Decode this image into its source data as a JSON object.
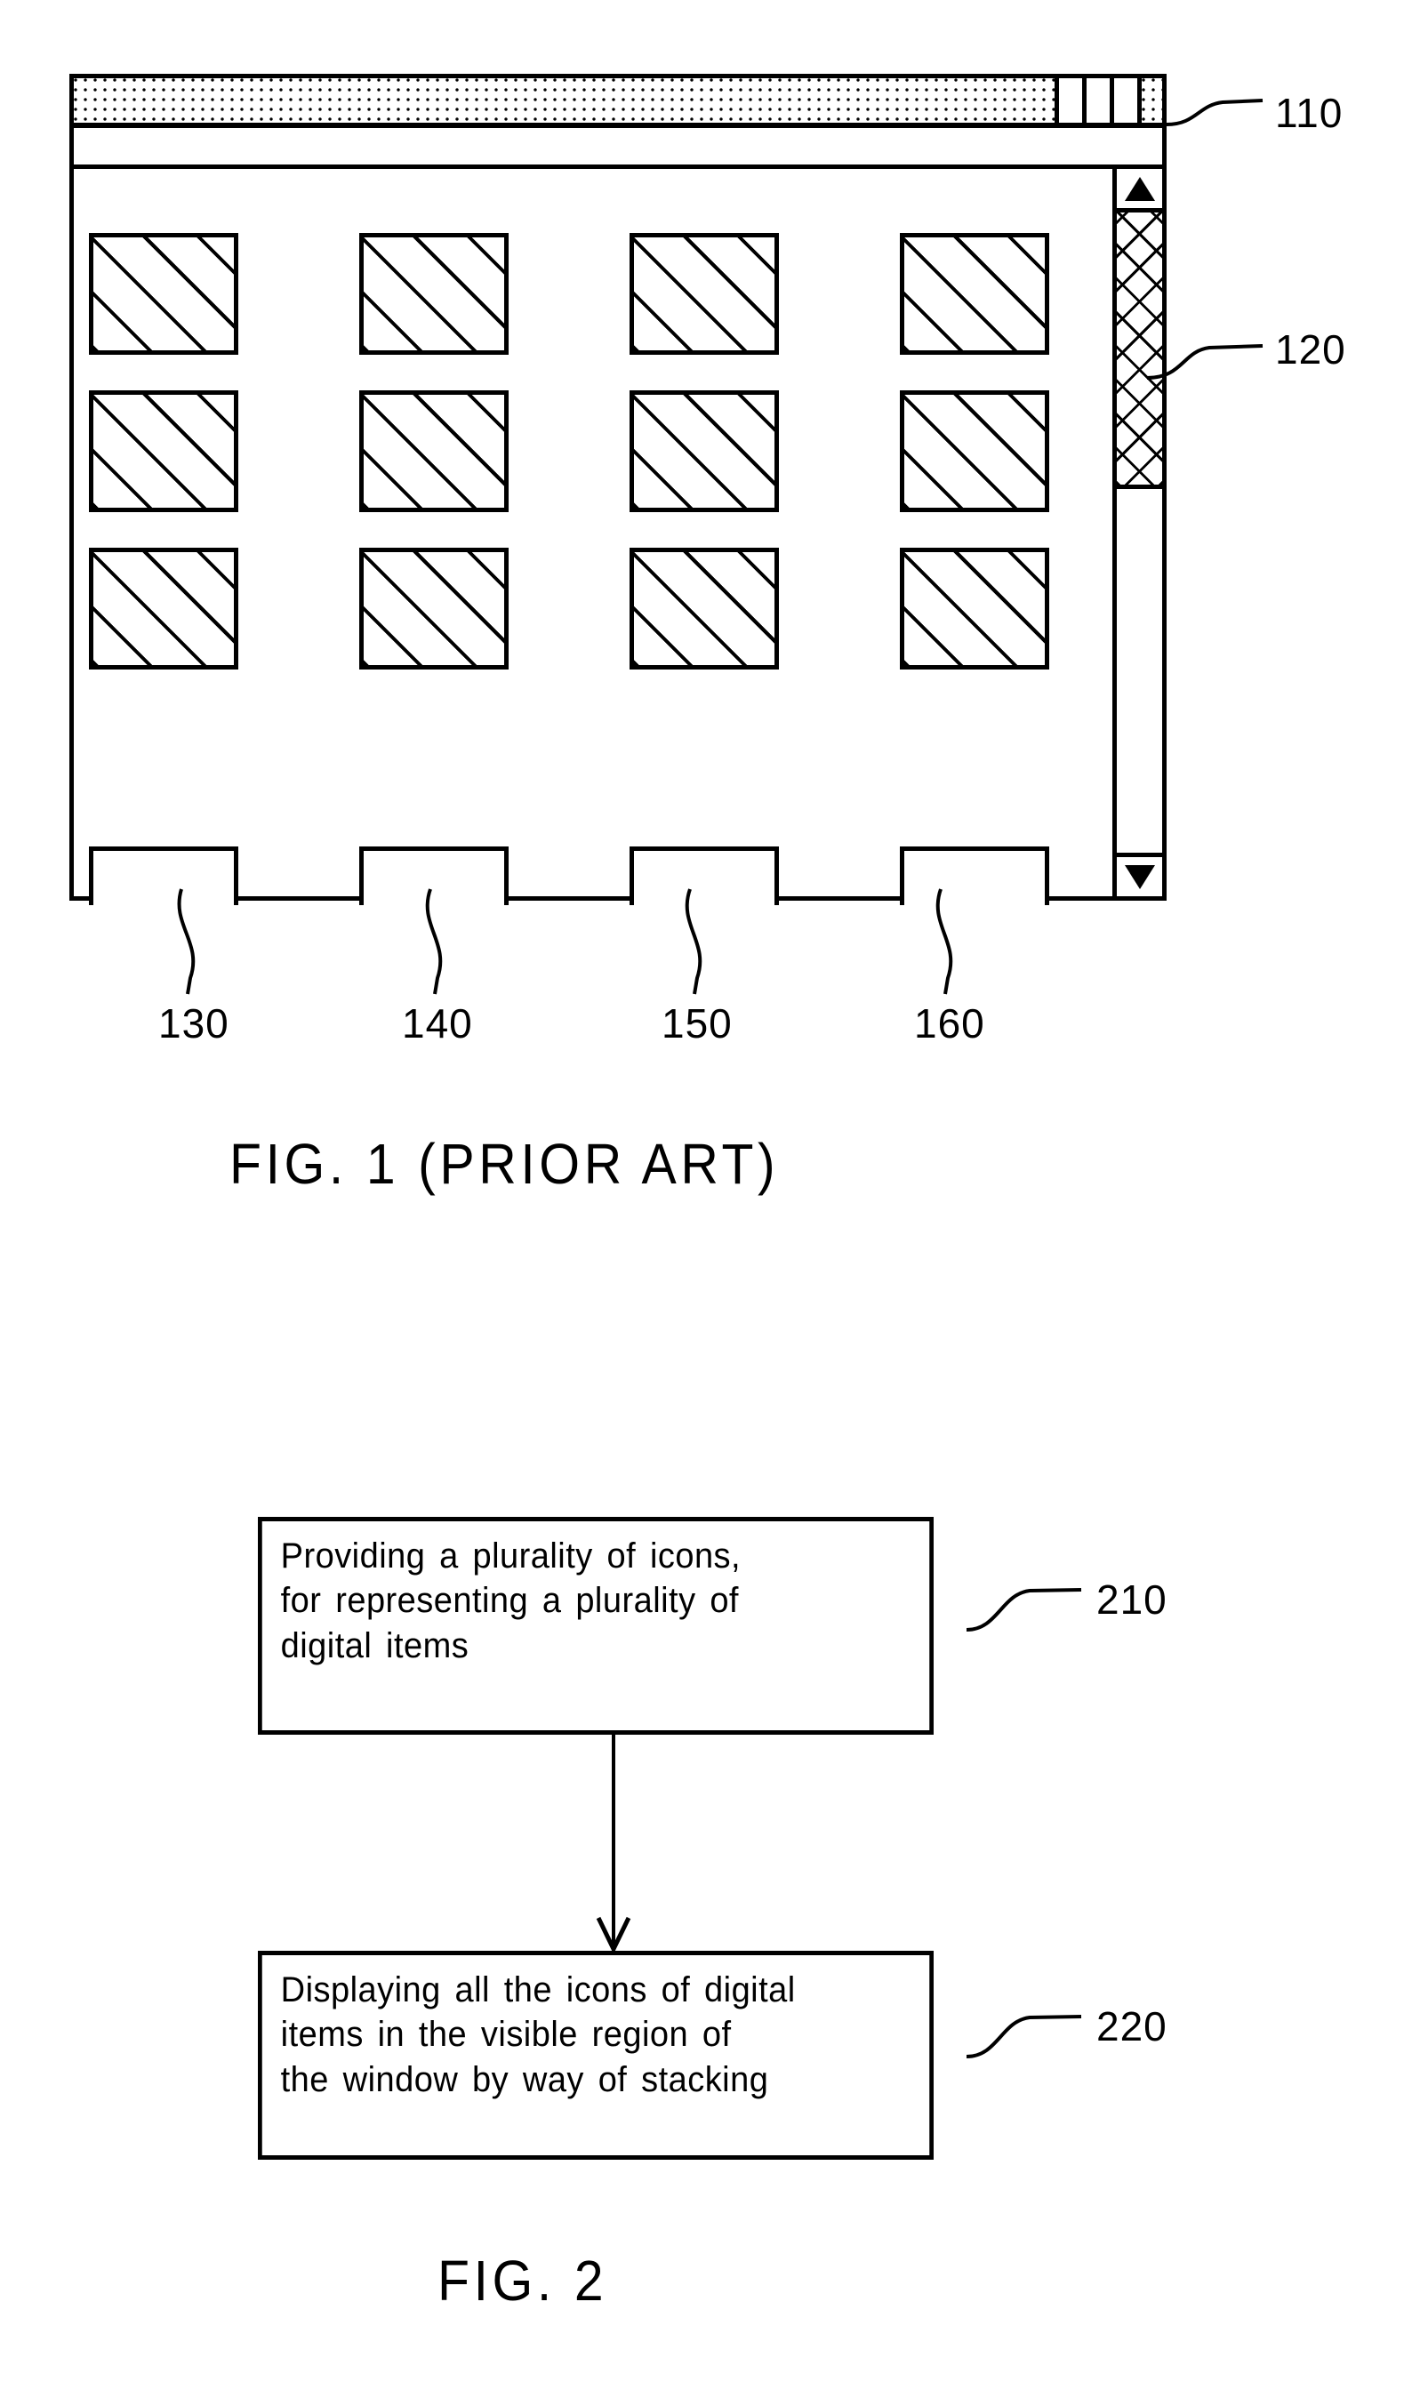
{
  "figure1": {
    "caption": "FIG. 1 (PRIOR ART)",
    "window": {
      "title_bar": {
        "name": "title-bar",
        "controls": [
          "minimize-button",
          "maximize-button",
          "close-button"
        ]
      },
      "toolbar": {
        "name": "menu-toolbar"
      },
      "scrollbar": {
        "up_arrow": "▲",
        "down_arrow": "▼",
        "thumb": "scroll-thumb"
      },
      "icon_grid": {
        "rows": 3,
        "columns": 4,
        "visible_icons": 12,
        "clipped_row_icons": 4
      }
    },
    "reference_numbers": [
      {
        "id": "110",
        "label": "110",
        "target": "window-frame"
      },
      {
        "id": "120",
        "label": "120",
        "target": "scrollbar-thumb"
      },
      {
        "id": "130",
        "label": "130",
        "target": "clipped-icon-1"
      },
      {
        "id": "140",
        "label": "140",
        "target": "clipped-icon-2"
      },
      {
        "id": "150",
        "label": "150",
        "target": "clipped-icon-3"
      },
      {
        "id": "160",
        "label": "160",
        "target": "clipped-icon-4"
      }
    ]
  },
  "figure2": {
    "caption": "FIG. 2",
    "steps": [
      {
        "ref": "210",
        "lines": [
          "Providing a plurality of icons,",
          "for representing a plurality of",
          "digital items"
        ]
      },
      {
        "ref": "220",
        "lines": [
          "Displaying all the icons of digital",
          "items in the visible region of",
          "the window by way of stacking"
        ]
      }
    ],
    "connector": "down-arrow"
  },
  "colors": {
    "ink": "#000000",
    "paper": "#ffffff"
  }
}
